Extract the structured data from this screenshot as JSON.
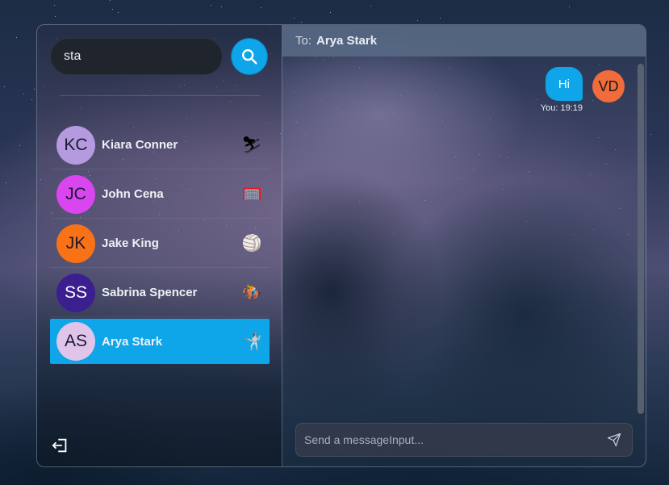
{
  "search": {
    "value": "sta"
  },
  "contacts": [
    {
      "initials": "KC",
      "name": "Kiara Conner",
      "avatar_color": "#b59ae0",
      "emoji": "⛷",
      "icon": "skier-icon",
      "active": false
    },
    {
      "initials": "JC",
      "name": "John Cena",
      "avatar_color": "#d946ef",
      "emoji": "🥅",
      "icon": "goal-net-icon",
      "active": false
    },
    {
      "initials": "JK",
      "name": "Jake King",
      "avatar_color": "#f97316",
      "emoji": "🏐",
      "icon": "volleyball-icon",
      "active": false
    },
    {
      "initials": "SS",
      "name": "Sabrina Spencer",
      "avatar_color": "#3b1f8f",
      "emoji": "🏇",
      "icon": "horse-racing-icon",
      "active": false
    },
    {
      "initials": "AS",
      "name": "Arya Stark",
      "avatar_color": "#e0c4ea",
      "emoji": "🤺",
      "icon": "fencer-icon",
      "active": true
    }
  ],
  "chat": {
    "to_label": "To:",
    "recipient": "Arya Stark",
    "messages": [
      {
        "text": "Hi",
        "sender_initials": "VD",
        "meta": "You: 19:19"
      }
    ],
    "composer_placeholder": "Send a messageInput..."
  },
  "colors": {
    "accent": "#0ea5e9",
    "own_avatar": "#f26b3a"
  }
}
